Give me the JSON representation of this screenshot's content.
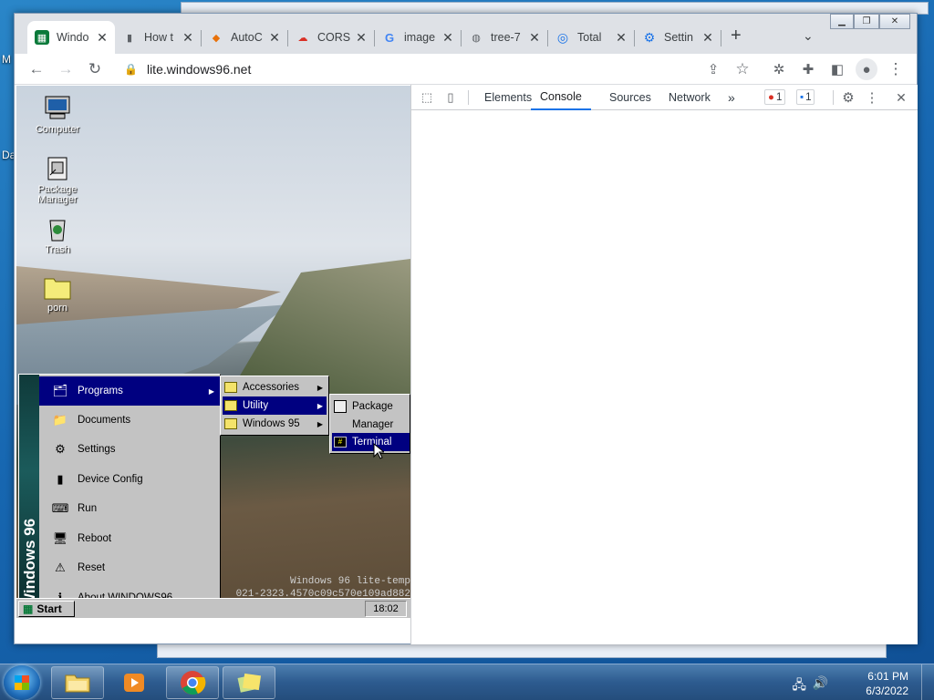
{
  "host": {
    "left_labels": [
      "M",
      "Da"
    ],
    "taskbar": {
      "items": [
        "file-explorer",
        "media-player",
        "chrome",
        "sticky-notes"
      ],
      "clock_time": "6:01 PM",
      "clock_date": "6/3/2022"
    }
  },
  "browser": {
    "tabs": [
      {
        "title": "Windo",
        "icon": "windows96-icon",
        "active": true
      },
      {
        "title": "How t",
        "icon": "mouse-icon"
      },
      {
        "title": "AutoC",
        "icon": "autocomplete-icon"
      },
      {
        "title": "CORS",
        "icon": "cors-icon"
      },
      {
        "title": "image",
        "icon": "google-icon"
      },
      {
        "title": "tree-7",
        "icon": "globe-icon"
      },
      {
        "title": "Total",
        "icon": "total-icon"
      },
      {
        "title": "Settin",
        "icon": "settings-icon"
      }
    ],
    "new_tab": "+",
    "url": "lite.windows96.net",
    "window_controls": [
      "minimize",
      "restore",
      "close"
    ]
  },
  "win96": {
    "desktop_icons": [
      {
        "label": "Computer",
        "icon": "computer-icon"
      },
      {
        "label": "Package Manager",
        "icon": "package-icon"
      },
      {
        "label": "Trash",
        "icon": "trash-icon"
      },
      {
        "label": "porn",
        "icon": "folder-icon"
      }
    ],
    "start_menu": {
      "brand": "Windows 96",
      "items": [
        {
          "label": "Programs",
          "icon": "programs-icon",
          "submenu": true,
          "selected": true
        },
        {
          "label": "Documents",
          "icon": "documents-icon"
        },
        {
          "label": "Settings",
          "icon": "settings-icon"
        },
        {
          "label": "Device Config",
          "icon": "device-icon"
        },
        {
          "label": "Run",
          "icon": "run-icon"
        },
        {
          "label": "Reboot",
          "icon": "reboot-icon"
        },
        {
          "label": "Reset",
          "icon": "reset-icon"
        },
        {
          "label": "About WINDOWS96",
          "icon": "about-icon"
        }
      ]
    },
    "programs_submenu": [
      {
        "label": "Accessories",
        "submenu": true
      },
      {
        "label": "Utility",
        "submenu": true,
        "selected": true
      },
      {
        "label": "Windows 95",
        "submenu": true
      }
    ],
    "utility_submenu": [
      {
        "label": "Package",
        "label2": "Manager",
        "icon": "package-icon"
      },
      {
        "label": "Terminal",
        "icon": "terminal-icon",
        "selected": true
      }
    ],
    "taskbar": {
      "start_label": "Start",
      "clock": "18:02"
    },
    "watermark_line1": "Windows 96 lite-temp",
    "watermark_line2": "021-2323.4570c09c570e109ad882"
  },
  "devtools": {
    "tabs": [
      "Elements",
      "Console",
      "Sources",
      "Network"
    ],
    "active_tab": "Console",
    "more": "»",
    "error_count": "1",
    "message_count": "1"
  }
}
